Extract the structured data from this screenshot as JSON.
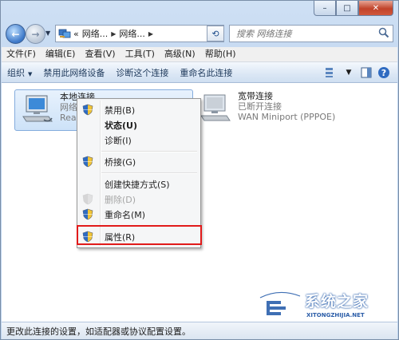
{
  "window": {
    "minimize_glyph": "–",
    "maximize_glyph": "□",
    "close_glyph": "✕"
  },
  "nav": {
    "back_glyph": "←",
    "forward_glyph": "→",
    "breadcrumb": [
      "«",
      "网络...",
      "网络...",
      ""
    ],
    "search_placeholder": "搜索 网络连接"
  },
  "menubar": {
    "items": [
      "文件(F)",
      "编辑(E)",
      "查看(V)",
      "工具(T)",
      "高级(N)",
      "帮助(H)"
    ]
  },
  "toolbar": {
    "organize": "组织",
    "disable_device": "禁用此网络设备",
    "diagnose": "诊断这个连接",
    "rename": "重命名此连接"
  },
  "connections": [
    {
      "name": "本地连接",
      "status": "网络",
      "device": "Realte"
    },
    {
      "name": "宽带连接",
      "status": "已断开连接",
      "device": "WAN Miniport (PPPOE)"
    }
  ],
  "context_menu": {
    "items": [
      {
        "label": "禁用(B)",
        "icon": "uac-shield-icon"
      },
      {
        "label": "状态(U)",
        "icon": ""
      },
      {
        "label": "诊断(I)",
        "icon": ""
      },
      {
        "label": "桥接(G)",
        "icon": "uac-shield-icon"
      },
      {
        "label": "创建快捷方式(S)",
        "icon": ""
      },
      {
        "label": "删除(D)",
        "icon": "uac-shield-icon"
      },
      {
        "label": "重命名(M)",
        "icon": "uac-shield-icon"
      },
      {
        "label": "属性(R)",
        "icon": "uac-shield-icon"
      }
    ],
    "highlight_color": "#e11a1a"
  },
  "statusbar": {
    "text": "更改此连接的设置，如适配器或协议配置设置。"
  },
  "watermark": {
    "title": "系统之家",
    "subtitle": "XITONGZHIJIA.NET"
  }
}
